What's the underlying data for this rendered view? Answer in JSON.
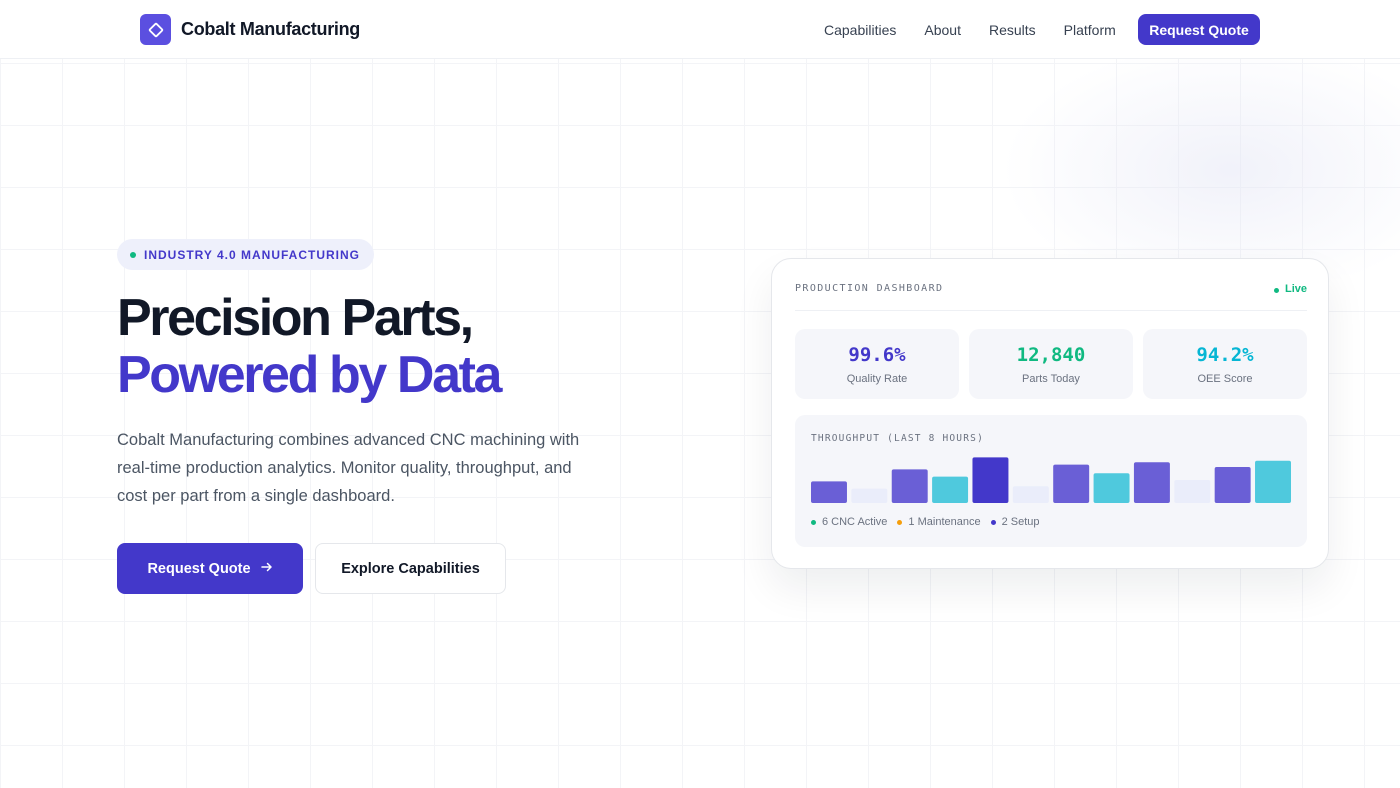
{
  "nav": {
    "brand": "Cobalt Manufacturing",
    "links": [
      "Capabilities",
      "About",
      "Results",
      "Platform"
    ],
    "cta": "Request Quote"
  },
  "hero": {
    "badge": "INDUSTRY 4.0 MANUFACTURING",
    "title_line1": "Precision Parts,",
    "title_line2": "Powered by Data",
    "lead": "Cobalt Manufacturing combines advanced CNC machining with real-time production analytics. Monitor quality, throughput, and cost per part from a single dashboard.",
    "primary_cta": "Request Quote",
    "secondary_cta": "Explore Capabilities"
  },
  "dashboard": {
    "title": "PRODUCTION DASHBOARD",
    "status": "Live",
    "stats": [
      {
        "value": "99.6%",
        "label": "Quality Rate",
        "color": "#4338ca"
      },
      {
        "value": "12,840",
        "label": "Parts Today",
        "color": "#10b981"
      },
      {
        "value": "94.2%",
        "label": "OEE Score",
        "color": "#06b6d4"
      }
    ],
    "throughput_title": "THROUGHPUT (LAST 8 HOURS)",
    "legend": [
      {
        "label": "6 CNC Active",
        "color": "#10b981"
      },
      {
        "label": "1 Maintenance",
        "color": "#f59e0b"
      },
      {
        "label": "2 Setup",
        "color": "#4338ca"
      }
    ]
  },
  "colors": {
    "accent": "#4338ca",
    "bar_primary": "#6a5fd6",
    "bar_dark": "#4338ca",
    "bar_cyan": "#4fc9dd",
    "bar_idle": "#eaedfa"
  },
  "chart_data": {
    "type": "bar",
    "values": [
      45,
      30,
      70,
      55,
      95,
      35,
      80,
      62,
      85,
      48,
      75,
      88
    ],
    "colors": [
      "#6a5fd6",
      "#eaedfa",
      "#6a5fd6",
      "#4fc9dd",
      "#4338ca",
      "#eaedfa",
      "#6a5fd6",
      "#4fc9dd",
      "#6a5fd6",
      "#eaedfa",
      "#6a5fd6",
      "#4fc9dd"
    ],
    "ylim": [
      0,
      100
    ]
  }
}
